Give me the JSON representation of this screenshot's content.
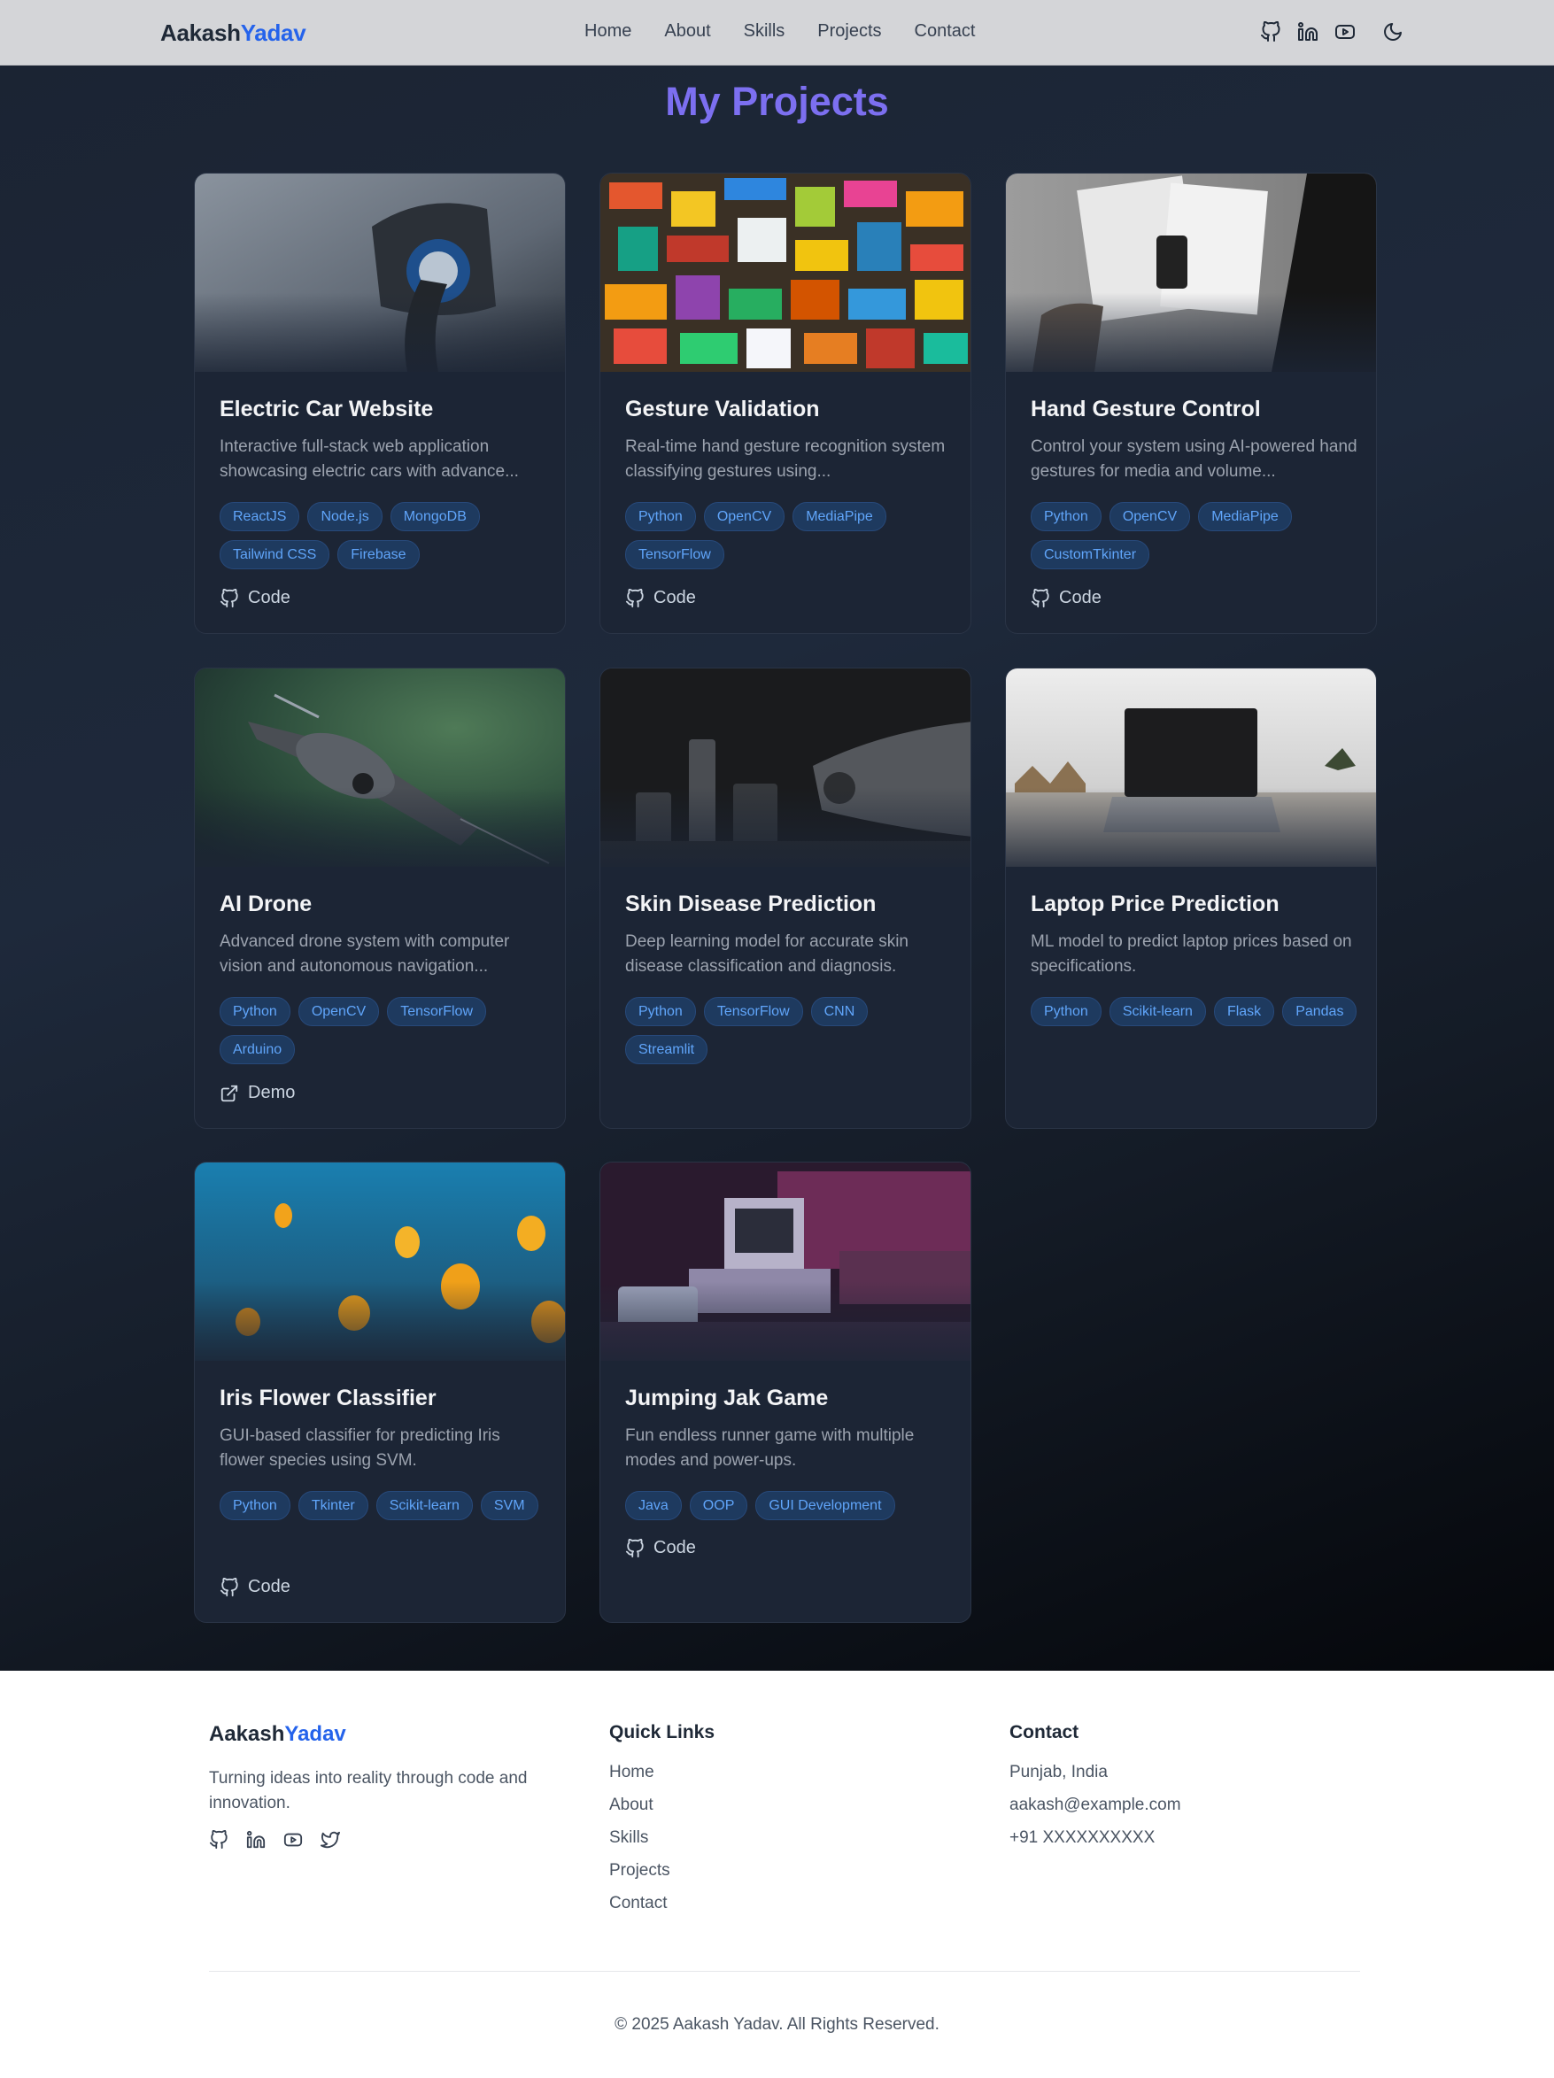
{
  "nav": {
    "logo_first": "Aakash",
    "logo_second": "Yadav",
    "links": [
      "Home",
      "About",
      "Skills",
      "Projects",
      "Contact"
    ],
    "icons": [
      "github-icon",
      "linkedin-icon",
      "youtube-icon",
      "moon-icon"
    ]
  },
  "projects": {
    "title": "My Projects",
    "cards": [
      {
        "title": "Electric Car Website",
        "desc": "Interactive full-stack web application showcasing electric cars with advance...",
        "tags": [
          "ReactJS",
          "Node.js",
          "MongoDB",
          "Tailwind CSS",
          "Firebase"
        ],
        "link": "Code",
        "link_icon": "github-icon"
      },
      {
        "title": "Gesture Validation",
        "desc": "Real-time hand gesture recognition system classifying gestures using...",
        "tags": [
          "Python",
          "OpenCV",
          "MediaPipe",
          "TensorFlow"
        ],
        "link": "Code",
        "link_icon": "github-icon"
      },
      {
        "title": "Hand Gesture Control",
        "desc": "Control your system using AI-powered hand gestures for media and volume...",
        "tags": [
          "Python",
          "OpenCV",
          "MediaPipe",
          "CustomTkinter"
        ],
        "link": "Code",
        "link_icon": "github-icon"
      },
      {
        "title": "AI Drone",
        "desc": "Advanced drone system with computer vision and autonomous navigation...",
        "tags": [
          "Python",
          "OpenCV",
          "TensorFlow",
          "Arduino"
        ],
        "link": "Demo",
        "link_icon": "external-link-icon"
      },
      {
        "title": "Skin Disease Prediction",
        "desc": "Deep learning model for accurate skin disease classification and diagnosis.",
        "tags": [
          "Python",
          "TensorFlow",
          "CNN",
          "Streamlit"
        ],
        "link": "",
        "link_icon": ""
      },
      {
        "title": "Laptop Price Prediction",
        "desc": "ML model to predict laptop prices based on specifications.",
        "tags": [
          "Python",
          "Scikit-learn",
          "Flask",
          "Pandas"
        ],
        "link": "",
        "link_icon": ""
      },
      {
        "title": "Iris Flower Classifier",
        "desc": "GUI-based classifier for predicting Iris flower species using SVM.",
        "tags": [
          "Python",
          "Tkinter",
          "Scikit-learn",
          "SVM"
        ],
        "link": "Code",
        "link_icon": "github-icon"
      },
      {
        "title": "Jumping Jak Game",
        "desc": "Fun endless runner game with multiple modes and power-ups.",
        "tags": [
          "Java",
          "OOP",
          "GUI Development"
        ],
        "link": "Code",
        "link_icon": "github-icon"
      }
    ]
  },
  "footer": {
    "logo_first": "Aakash",
    "logo_second": "Yadav",
    "tagline": "Turning ideas into reality through code and innovation.",
    "social_icons": [
      "github-icon",
      "linkedin-icon",
      "youtube-icon",
      "twitter-icon"
    ],
    "quick_links_title": "Quick Links",
    "quick_links": [
      "Home",
      "About",
      "Skills",
      "Projects",
      "Contact"
    ],
    "contact_title": "Contact",
    "contact": [
      "Punjab, India",
      "aakash@example.com",
      "+91 XXXXXXXXXX"
    ],
    "copyright": "© 2025 Aakash Yadav. All Rights Reserved."
  },
  "colors": {
    "accent": "#2563eb",
    "title_purple": "#7c6ff0",
    "tag_text": "#60a5fa",
    "tag_bg": "#1e3a5f"
  }
}
